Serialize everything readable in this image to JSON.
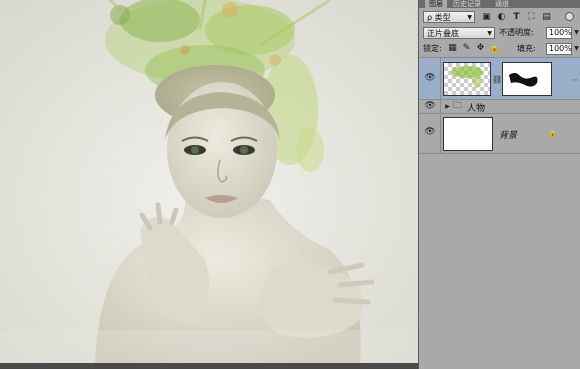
{
  "panel": {
    "tabs": [
      {
        "label": "图层",
        "active": true
      },
      {
        "label": "历史记录",
        "active": false
      },
      {
        "label": "通道",
        "active": false
      }
    ],
    "filter": {
      "value": "ρ 类型",
      "icons": [
        "image-filter-icon",
        "adjustment-filter-icon",
        "type-filter-icon",
        "shape-filter-icon",
        "smart-object-filter-icon"
      ],
      "type_glyph": "T"
    },
    "blend_mode": {
      "value": "正片叠底"
    },
    "opacity": {
      "label": "不透明度:",
      "value": "100%"
    },
    "lock": {
      "label": "锁定:",
      "icons": [
        "lock-transparent-icon",
        "lock-brush-icon",
        "lock-move-icon",
        "lock-all-icon"
      ]
    },
    "fill": {
      "label": "填充:",
      "value": "100%"
    },
    "layers": [
      {
        "name": "",
        "type": "masked-pixel-layer",
        "visible": true,
        "selected": true
      },
      {
        "name": "人物",
        "type": "group",
        "visible": true,
        "selected": false
      },
      {
        "name": "背景",
        "type": "background",
        "visible": true,
        "selected": false,
        "locked": true
      }
    ]
  },
  "colors": {
    "panel_bg": "#a9a9a9",
    "selected_layer": "#9aaec9",
    "canvas_bg": "#e6e6df",
    "splash_green": "#8fbf3a"
  }
}
